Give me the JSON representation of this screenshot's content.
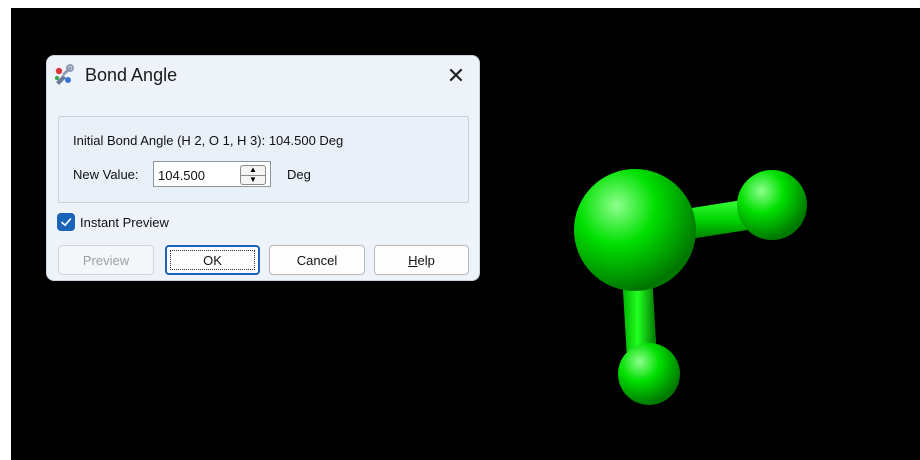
{
  "dialog": {
    "title": "Bond Angle",
    "close_glyph": "✕",
    "initial_angle_text": "Initial Bond Angle (H 2, O 1, H 3): 104.500 Deg",
    "new_value_label": "New Value:",
    "new_value": "104.500",
    "unit": "Deg",
    "instant_preview_label": "Instant Preview",
    "instant_preview_checked": true,
    "buttons": {
      "preview": "Preview",
      "ok": "OK",
      "cancel": "Cancel",
      "help_first": "H",
      "help_rest": "elp"
    }
  },
  "icons": {
    "title": "molecule-wrench-icon",
    "close": "close-icon",
    "spin_up": "spin-up-icon",
    "spin_down": "spin-down-icon",
    "check": "checkmark-icon"
  },
  "colors": {
    "viewport_background": "#000000",
    "atom_color": "#00e000",
    "dialog_background": "#eef3fa",
    "accent": "#1a63b9"
  }
}
